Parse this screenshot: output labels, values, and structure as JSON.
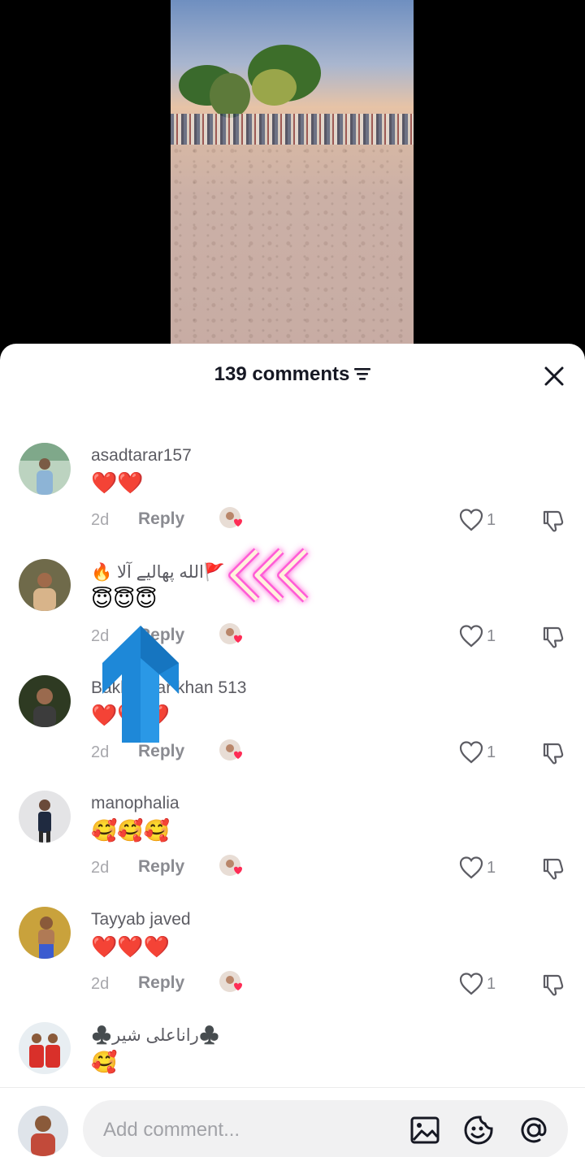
{
  "sheet": {
    "title": "139 comments",
    "close_label": "close"
  },
  "comments": [
    {
      "username": "asadtarar157",
      "text": "❤️❤️",
      "time": "2d",
      "reply_label": "Reply",
      "likes": "1"
    },
    {
      "username": "🚩الله پهالیے آلا 🔥",
      "text": "😇😇😇",
      "time": "2d",
      "reply_label": "Reply",
      "likes": "1"
    },
    {
      "username": "Bakhtawar khan 513",
      "text": "❤️❤️❤️",
      "time": "2d",
      "reply_label": "Reply",
      "likes": "1"
    },
    {
      "username": "manophalia",
      "text": "🥰🥰🥰",
      "time": "2d",
      "reply_label": "Reply",
      "likes": "1"
    },
    {
      "username": "Tayyab javed",
      "text": "❤️❤️❤️",
      "time": "2d",
      "reply_label": "Reply",
      "likes": "1"
    },
    {
      "username": "♣️راناعلی شیر♣️",
      "text": "🥰",
      "time": "",
      "reply_label": "",
      "likes": ""
    }
  ],
  "input_bar": {
    "placeholder": "Add comment..."
  },
  "icons": {
    "filter": "filter-icon",
    "close": "close-icon",
    "like": "heart-outline-icon",
    "dislike": "thumbs-down-icon",
    "creator_liked": "creator-liked-badge-icon",
    "image": "image-icon",
    "emoji": "emoji-icon",
    "mention": "at-mention-icon"
  },
  "colors": {
    "text_primary": "#161823",
    "text_secondary": "#8a8b91",
    "like_heart": "#fe2c55",
    "overlay_arrow": "#1e88d8",
    "overlay_chevron_glow": "#ff5bd6"
  }
}
